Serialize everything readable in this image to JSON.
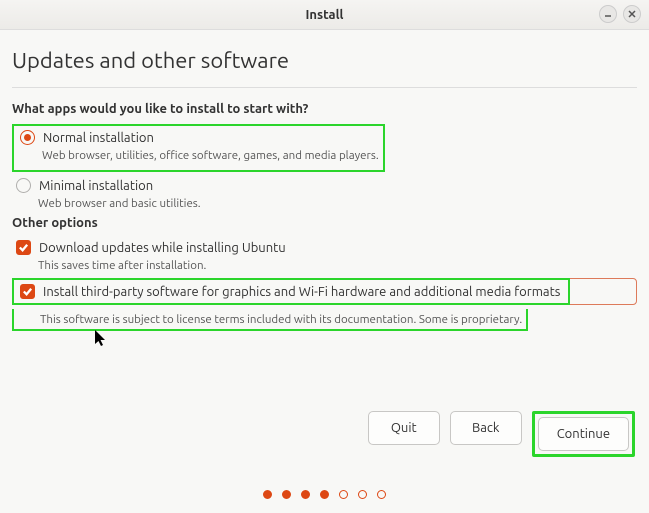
{
  "window": {
    "title": "Install"
  },
  "page": {
    "title": "Updates and other software"
  },
  "apps_section": {
    "label": "What apps would you like to install to start with?",
    "normal": {
      "label": "Normal installation",
      "desc": "Web browser, utilities, office software, games, and media players.",
      "selected": true
    },
    "minimal": {
      "label": "Minimal installation",
      "desc": "Web browser and basic utilities.",
      "selected": false
    }
  },
  "other_section": {
    "label": "Other options",
    "updates": {
      "label": "Download updates while installing Ubuntu",
      "desc": "This saves time after installation.",
      "checked": true
    },
    "thirdparty": {
      "label": "Install third-party software for graphics and Wi-Fi hardware and additional media formats",
      "desc": "This software is subject to license terms included with its documentation. Some is proprietary.",
      "checked": true
    }
  },
  "buttons": {
    "quit": "Quit",
    "back": "Back",
    "continue": "Continue"
  },
  "progress": {
    "total": 7,
    "current": 4
  }
}
